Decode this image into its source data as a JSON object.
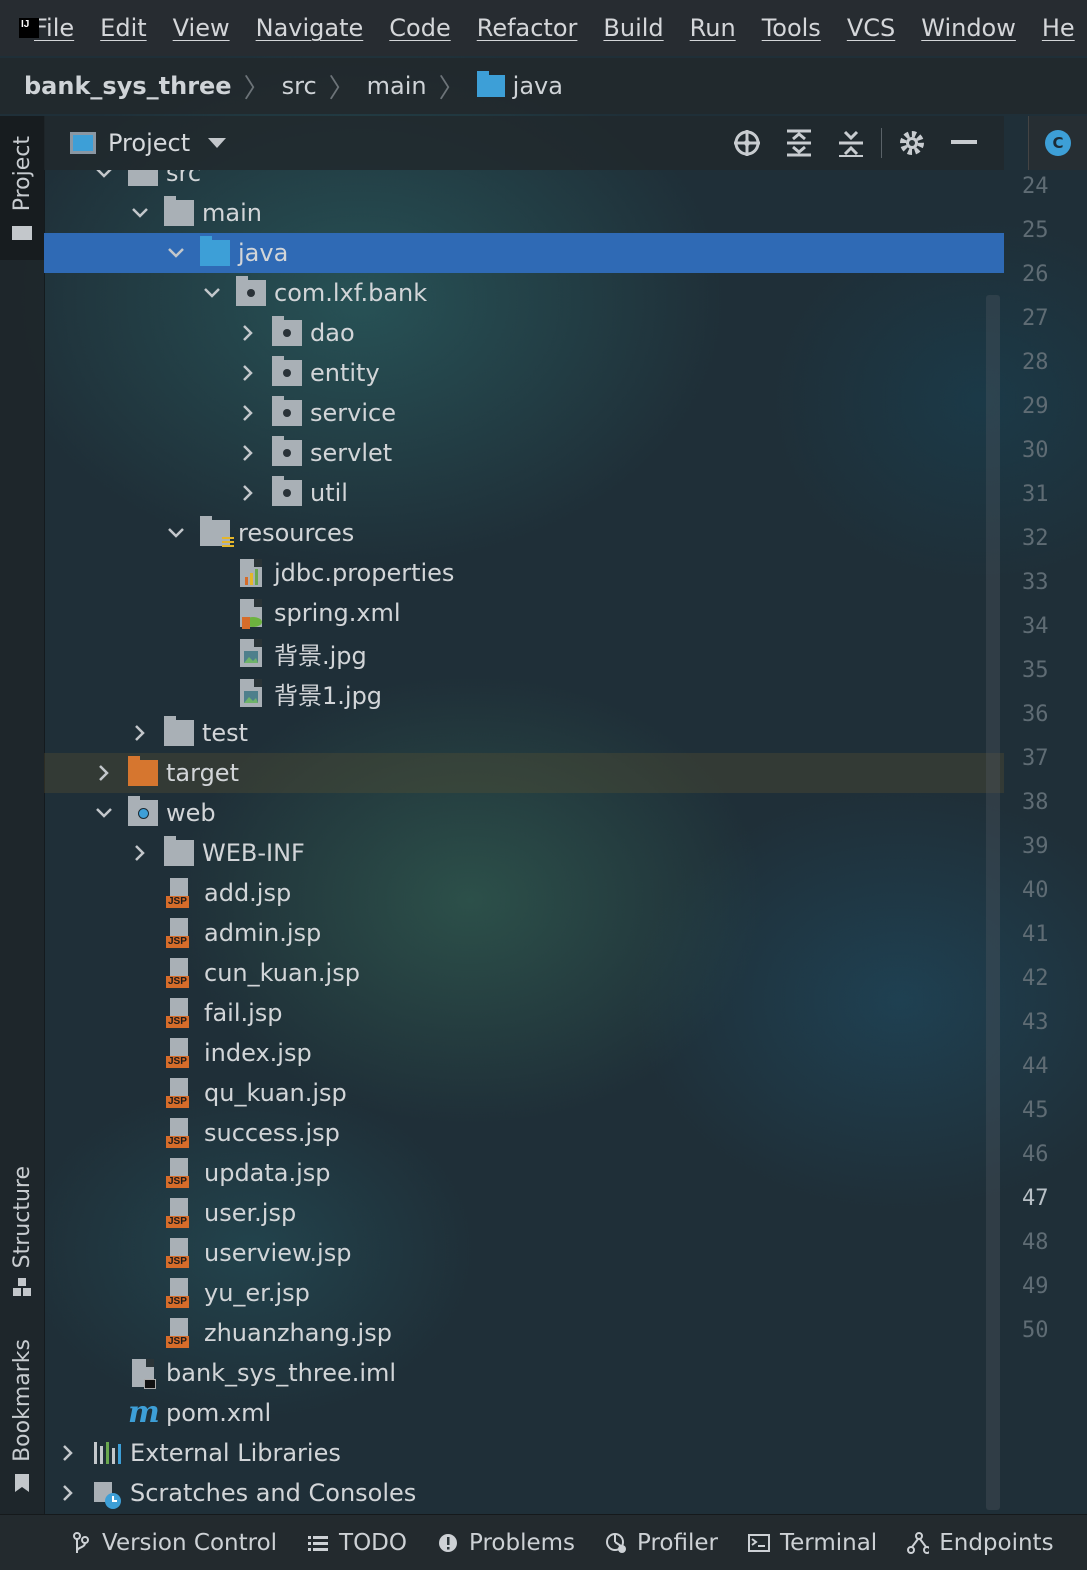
{
  "menubar": {
    "logo_text": "IJ",
    "items": [
      "File",
      "Edit",
      "View",
      "Navigate",
      "Code",
      "Refactor",
      "Build",
      "Run",
      "Tools",
      "VCS",
      "Window",
      "He"
    ]
  },
  "breadcrumb": [
    "bank_sys_three",
    "src",
    "main",
    "java"
  ],
  "left_strip": {
    "project": "Project",
    "structure": "Structure",
    "bookmarks": "Bookmarks"
  },
  "project_panel": {
    "title": "Project"
  },
  "tree": [
    {
      "label": "src",
      "type": "folder-gray",
      "expanded": true
    },
    {
      "label": "main",
      "type": "folder-gray",
      "expanded": true
    },
    {
      "label": "java",
      "type": "folder-blue",
      "expanded": true,
      "selected": true
    },
    {
      "label": "com.lxf.bank",
      "type": "package",
      "expanded": true
    },
    {
      "label": "dao",
      "type": "package",
      "expanded": false
    },
    {
      "label": "entity",
      "type": "package",
      "expanded": false
    },
    {
      "label": "service",
      "type": "package",
      "expanded": false
    },
    {
      "label": "servlet",
      "type": "package",
      "expanded": false
    },
    {
      "label": "util",
      "type": "package",
      "expanded": false
    },
    {
      "label": "resources",
      "type": "resources",
      "expanded": true
    },
    {
      "label": "jdbc.properties",
      "type": "properties"
    },
    {
      "label": "spring.xml",
      "type": "spring"
    },
    {
      "label": "背景.jpg",
      "type": "image"
    },
    {
      "label": "背景1.jpg",
      "type": "image"
    },
    {
      "label": "test",
      "type": "folder-gray",
      "expanded": false
    },
    {
      "label": "target",
      "type": "folder-orange",
      "expanded": false,
      "excluded": true
    },
    {
      "label": "web",
      "type": "web",
      "expanded": true
    },
    {
      "label": "WEB-INF",
      "type": "folder-gray",
      "expanded": false
    },
    {
      "label": "add.jsp",
      "type": "jsp"
    },
    {
      "label": "admin.jsp",
      "type": "jsp"
    },
    {
      "label": "cun_kuan.jsp",
      "type": "jsp"
    },
    {
      "label": "fail.jsp",
      "type": "jsp"
    },
    {
      "label": "index.jsp",
      "type": "jsp"
    },
    {
      "label": "qu_kuan.jsp",
      "type": "jsp"
    },
    {
      "label": "success.jsp",
      "type": "jsp"
    },
    {
      "label": "updata.jsp",
      "type": "jsp"
    },
    {
      "label": "user.jsp",
      "type": "jsp"
    },
    {
      "label": "userview.jsp",
      "type": "jsp"
    },
    {
      "label": "yu_er.jsp",
      "type": "jsp"
    },
    {
      "label": "zhuanzhang.jsp",
      "type": "jsp"
    },
    {
      "label": "bank_sys_three.iml",
      "type": "iml"
    },
    {
      "label": "pom.xml",
      "type": "maven"
    },
    {
      "label": "External Libraries",
      "type": "libraries",
      "expanded": false
    },
    {
      "label": "Scratches and Consoles",
      "type": "scratches",
      "expanded": false
    }
  ],
  "gutter": {
    "lines": [
      "24",
      "25",
      "26",
      "27",
      "28",
      "29",
      "30",
      "31",
      "32",
      "33",
      "34",
      "35",
      "36",
      "37",
      "38",
      "39",
      "40",
      "41",
      "42",
      "43",
      "44",
      "45",
      "46",
      "47",
      "48",
      "49",
      "50"
    ],
    "current": "47"
  },
  "editor_tab_badge": "C",
  "statusbar": [
    "Version Control",
    "TODO",
    "Problems",
    "Profiler",
    "Terminal",
    "Endpoints"
  ],
  "colors": {
    "selection": "#2f6ab5",
    "folder_blue": "#3d9fd7",
    "jsp_orange": "#d66c2a",
    "target_orange": "#d6762f"
  }
}
